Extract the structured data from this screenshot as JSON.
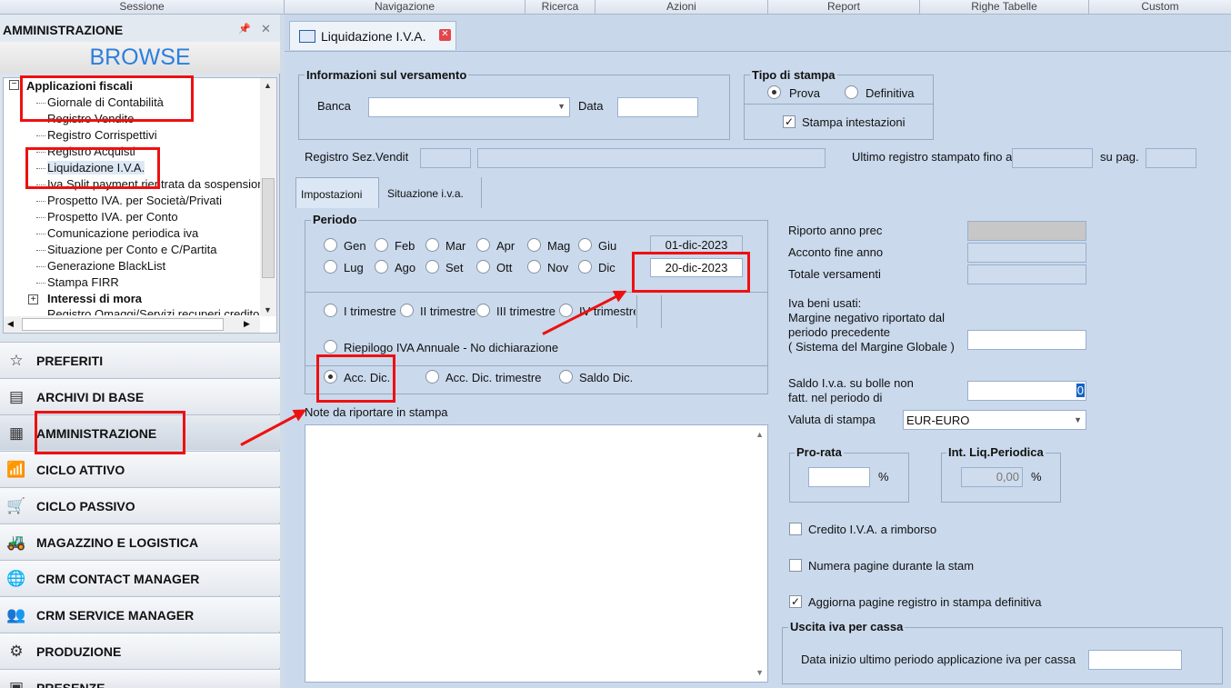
{
  "menu": {
    "items": [
      "Sessione",
      "Navigazione",
      "Ricerca",
      "Azioni",
      "Report",
      "Righe Tabelle",
      "Custom"
    ]
  },
  "left": {
    "title": "AMMINISTRAZIONE",
    "browse": "BROWSE",
    "tree": {
      "root": "Applicazioni fiscali",
      "items": [
        "Giornale di Contabilità",
        "Registro Vendite",
        "Registro Corrispettivi",
        "Registro Acquisti",
        "Liquidazione I.V.A.",
        "Iva Split payment rientrata da sospensione",
        "Prospetto IVA. per Società/Privati",
        "Prospetto IVA. per Conto",
        "Comunicazione periodica iva",
        "Situazione per Conto e C/Partita",
        "Generazione BlackList",
        "Stampa FIRR"
      ],
      "root2": "Interessi di mora",
      "partial": "Registro Omaggi/Servizi recuperi credito"
    },
    "modules": [
      "PREFERITI",
      "ARCHIVI DI BASE",
      "AMMINISTRAZIONE",
      "CICLO ATTIVO",
      "CICLO PASSIVO",
      "MAGAZZINO E LOGISTICA",
      "CRM CONTACT MANAGER",
      "CRM SERVICE MANAGER",
      "PRODUZIONE",
      "PRESENZE"
    ]
  },
  "tab": {
    "title": "Liquidazione I.V.A."
  },
  "form": {
    "versamento": {
      "title": "Informazioni sul versamento",
      "banca": "Banca",
      "data": "Data"
    },
    "tipo": {
      "title": "Tipo di stampa",
      "prova": "Prova",
      "definitiva": "Definitiva",
      "intestazioni": "Stampa intestazioni"
    },
    "registro": "Registro Sez.Vendit",
    "ultimo": "Ultimo registro stampato fino a",
    "supag": "su pag.",
    "subtabs": [
      "Impostazioni",
      "Situazione i.v.a."
    ],
    "periodo": {
      "title": "Periodo",
      "months1": [
        "Gen",
        "Feb",
        "Mar",
        "Apr",
        "Mag",
        "Giu"
      ],
      "months2": [
        "Lug",
        "Ago",
        "Set",
        "Ott",
        "Nov",
        "Dic"
      ],
      "date_from": "01-dic-2023",
      "date_to": "20-dic-2023"
    },
    "trimestri": [
      "I trimestre",
      "II trimestre",
      "III trimestre",
      "IV trimestre"
    ],
    "riepilogo": "Riepilogo IVA Annuale - No dichiarazione",
    "acc": [
      "Acc. Dic.",
      "Acc. Dic. trimestre",
      "Saldo Dic."
    ],
    "note": "Note da riportare in stampa",
    "riporto": "Riporto anno prec",
    "acconto": "Acconto fine anno",
    "totale": "Totale versamenti",
    "beni": [
      "Iva beni usati:",
      "Margine negativo riportato dal",
      "periodo precedente",
      "( Sistema del Margine Globale )"
    ],
    "saldo": [
      "Saldo I.v.a. su bolle non",
      "fatt. nel periodo di"
    ],
    "saldo_val": "0",
    "valuta": "Valuta di stampa",
    "valuta_val": "EUR-EURO",
    "prorata": {
      "title": "Pro-rata",
      "unit": "%"
    },
    "intliq": {
      "title": "Int. Liq.Periodica",
      "value": "0,00",
      "unit": "%"
    },
    "credito": "Credito I.V.A. a rimborso",
    "numera": "Numera pagine durante la stam",
    "aggiorna": "Aggiorna pagine registro in stampa definitiva",
    "uscita": {
      "title": "Uscita iva per cassa",
      "label": "Data inizio ultimo periodo applicazione iva per cassa"
    }
  }
}
